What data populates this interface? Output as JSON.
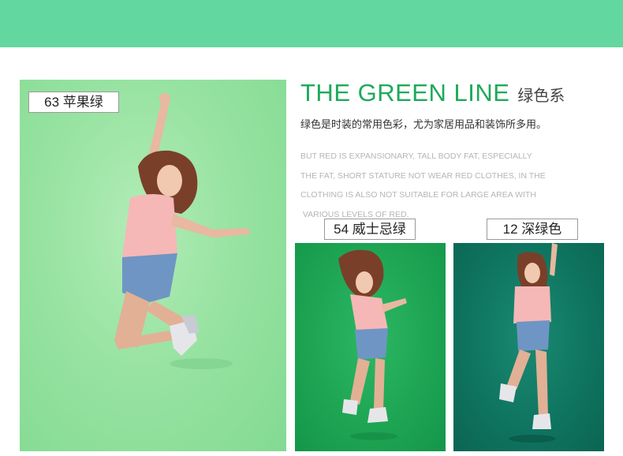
{
  "header_band": {
    "color": "#63d7a0"
  },
  "headline": {
    "english": "THE GREEN LINE",
    "chinese": "绿色系",
    "accent_color": "#1eaa5a"
  },
  "subtitle": "绿色是时装的常用色彩，尤为家居用品和装饰所多用。",
  "body_lines": [
    "BUT RED IS EXPANSIONARY, TALL BODY FAT, ESPECIALLY",
    "THE FAT, SHORT STATURE NOT WEAR RED CLOTHES, IN THE",
    "CLOTHING IS ALSO NOT SUITABLE FOR LARGE AREA WITH",
    " VARIOUS LEVELS OF RED."
  ],
  "swatches": [
    {
      "label": "63 苹果绿",
      "color": "#98e3a2"
    },
    {
      "label": "54 威士忌绿",
      "color": "#1ea553"
    },
    {
      "label": "12 深绿色",
      "color": "#0f7560"
    }
  ]
}
